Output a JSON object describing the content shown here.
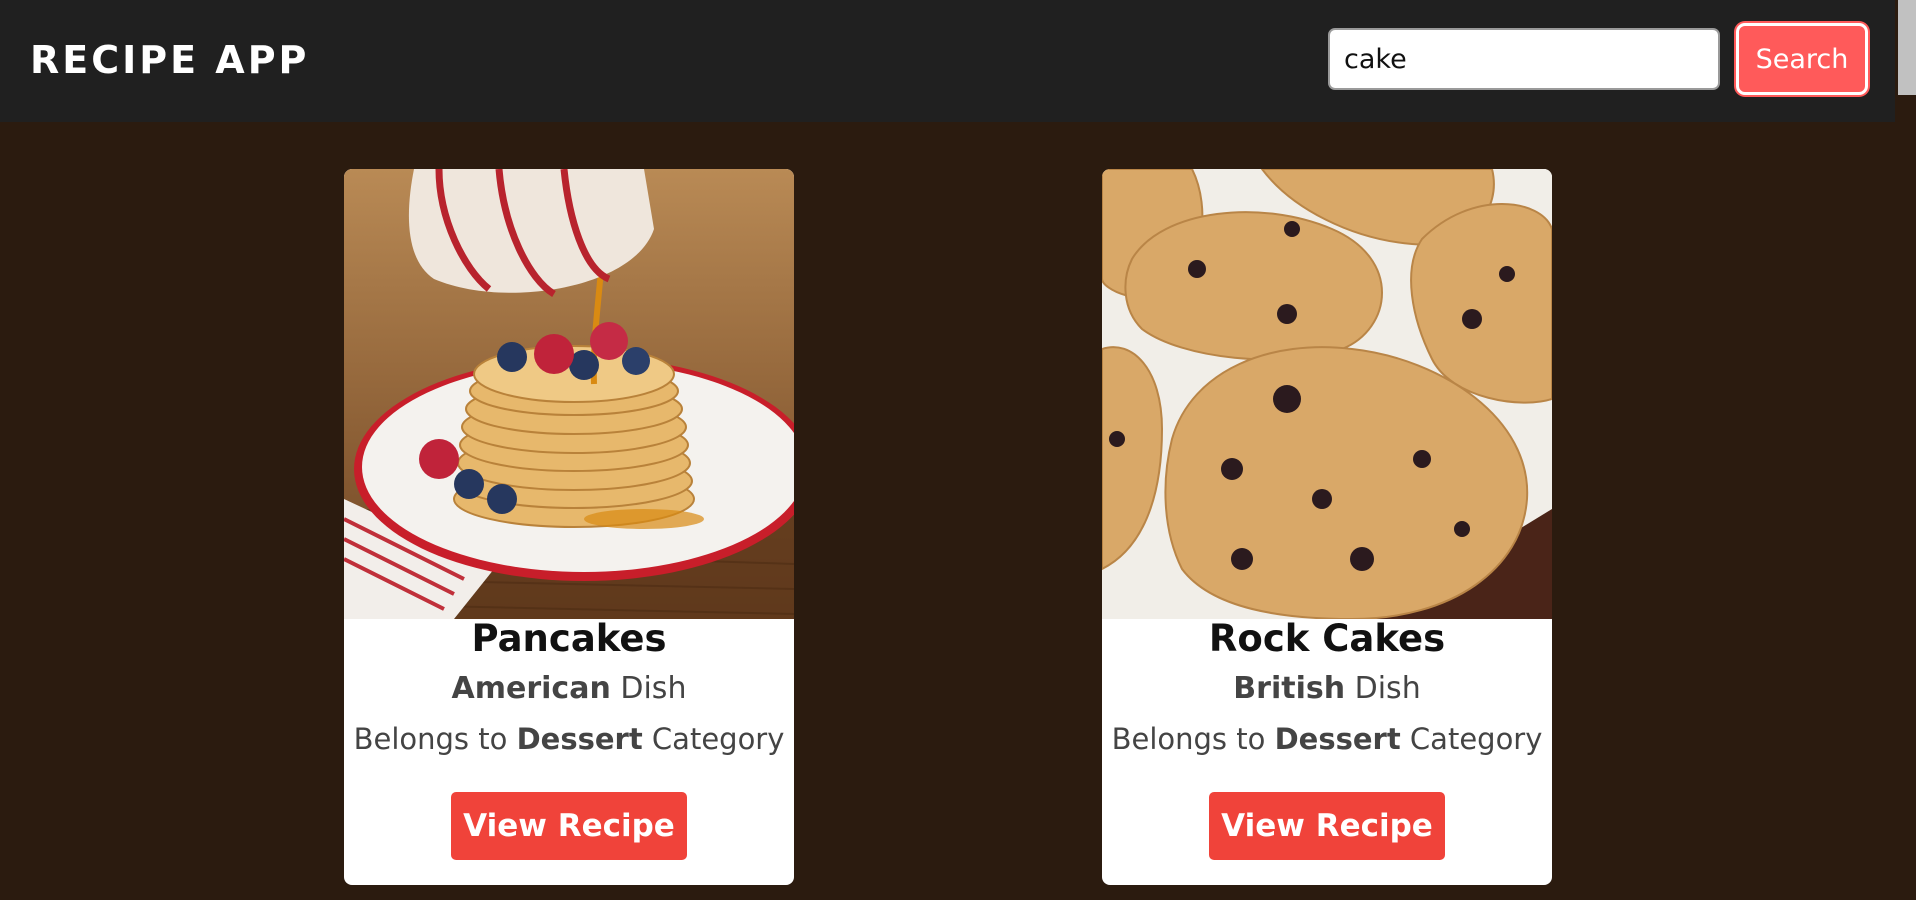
{
  "header": {
    "title": "RECIPE APP",
    "search_value": "cake",
    "search_button_label": "Search"
  },
  "colors": {
    "header_bg": "#202020",
    "page_bg": "#2b1b0f",
    "accent": "#f0433a",
    "search_button": "#ff5a5a"
  },
  "recipes": [
    {
      "name": "Pancakes",
      "area": "American",
      "area_suffix": "Dish",
      "category_prefix": "Belongs to",
      "category": "Dessert",
      "category_suffix": "Category",
      "button_label": "View Recipe",
      "image": "pancakes-photo"
    },
    {
      "name": "Rock Cakes",
      "area": "British",
      "area_suffix": "Dish",
      "category_prefix": "Belongs to",
      "category": "Dessert",
      "category_suffix": "Category",
      "button_label": "View Recipe",
      "image": "rock-cakes-photo"
    }
  ]
}
